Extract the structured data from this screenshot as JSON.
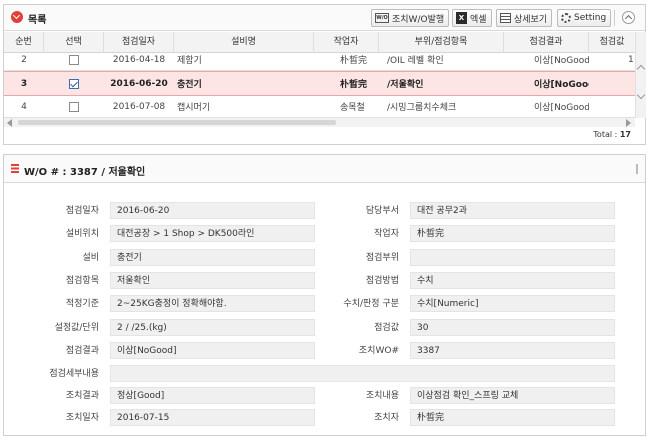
{
  "list_panel": {
    "title": "목록",
    "buttons": {
      "wo_issue": "조치W/O발행",
      "excel": "엑셀",
      "detail": "상세보기",
      "setting": "Setting"
    },
    "icons": {
      "title": "chevron-down-circle-icon",
      "wo_issue": "wo-document-icon",
      "excel": "excel-icon",
      "detail": "detail-list-icon",
      "setting": "gear-icon",
      "collapse": "chevron-up-circle-icon"
    },
    "columns": [
      "순번",
      "선택",
      "점검일자",
      "설비명",
      "작업자",
      "부위/점검항목",
      "점검결과",
      "점검값"
    ],
    "rows": [
      {
        "no": "2",
        "checked": false,
        "date": "2016-04-18",
        "equipment": "제함기",
        "worker": "朴晳完",
        "item": "/OIL 레벨 확인",
        "result": "이상[NoGood",
        "value": "1"
      },
      {
        "no": "3",
        "checked": true,
        "date": "2016-06-20",
        "equipment": "충전기",
        "worker": "朴晳完",
        "item": "/저울확인",
        "result": "이상[NoGood",
        "value": ""
      },
      {
        "no": "4",
        "checked": false,
        "date": "2016-07-08",
        "equipment": "캡시머기",
        "worker": "송목철",
        "item": "/시밍그룹치수체크",
        "result": "이상[NoGood",
        "value": ""
      }
    ],
    "total_label": "Total : ",
    "total_count": "17"
  },
  "detail_panel": {
    "title": "W/O # : 3387 / 저울확인",
    "icon": "list-icon",
    "fields": {
      "insp_date_label": "점검일자",
      "insp_date": "2016-06-20",
      "dept_label": "담당부서",
      "dept": "대전 공무2과",
      "location_label": "설비위치",
      "location": "대전공장 > 1 Shop > DK500라인",
      "worker_label": "작업자",
      "worker": "朴晳完",
      "equipment_label": "설비",
      "equipment": "충전기",
      "part_label": "점검부위",
      "part": "",
      "item_label": "점검항목",
      "item": "저울확인",
      "method_label": "점검방법",
      "method": "수치",
      "standard_label": "적정기준",
      "standard": "2~25KG충정이 정확해야함.",
      "judge_label": "수치/판정 구분",
      "judge": "수치[Numeric]",
      "setting_label": "설정값/단위",
      "setting": "2 / /25.(kg)",
      "value_label": "점검값",
      "value": "30",
      "result_label": "점검결과",
      "result": "이상[NoGood]",
      "action_wo_label": "조치WO#",
      "action_wo": "3387",
      "remark_label": "점검세부내용",
      "remark": "",
      "action_result_label": "조치결과",
      "action_result": "정상[Good]",
      "action_content_label": "조치내용",
      "action_content": "이상점검 확인_스프링 교체",
      "action_date_label": "조치일자",
      "action_date": "2016-07-15",
      "action_person_label": "조치자",
      "action_person": "朴晳完"
    }
  }
}
